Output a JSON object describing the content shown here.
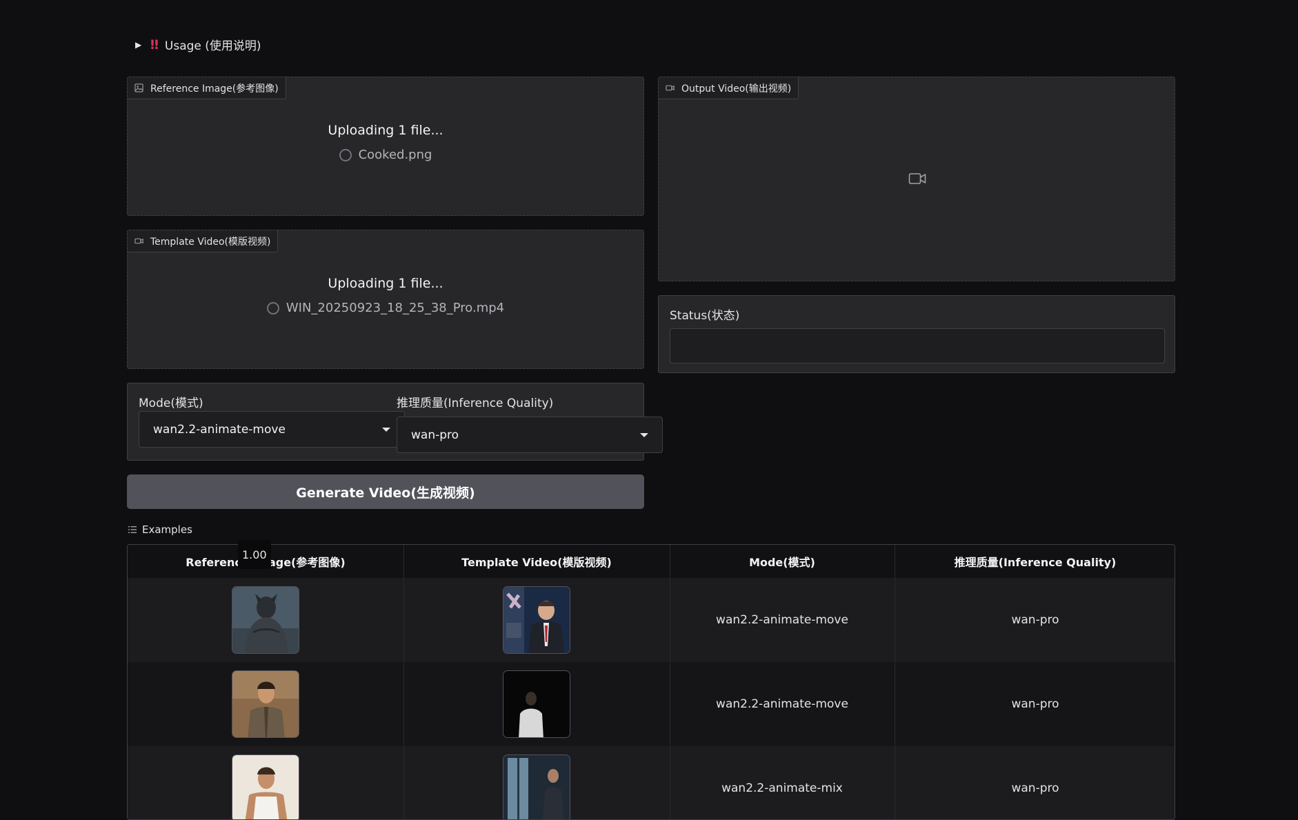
{
  "usage": {
    "label": "Usage (使用说明)",
    "arrow": "▶",
    "bang": "‼"
  },
  "reference_image": {
    "label": "Reference Image(参考图像)",
    "uploading": "Uploading 1 file...",
    "file": "Cooked.png"
  },
  "template_video": {
    "label": "Template Video(模版视频)",
    "uploading": "Uploading 1 file...",
    "file": "WIN_20250923_18_25_38_Pro.mp4"
  },
  "output_video": {
    "label": "Output Video(输出视频)"
  },
  "status": {
    "label": "Status(状态)",
    "value": ""
  },
  "mode": {
    "label": "Mode(模式)",
    "value": "wan2.2-animate-move"
  },
  "quality": {
    "label": "推理质量(Inference Quality)",
    "value": "wan-pro"
  },
  "generate_button": "Generate Video(生成视频)",
  "examples": {
    "label": "Examples",
    "tooltip": "1.00",
    "headers": [
      "Reference Image(参考图像)",
      "Template Video(模版视频)",
      "Mode(模式)",
      "推理质量(Inference Quality)"
    ],
    "rows": [
      {
        "mode": "wan2.2-animate-move",
        "quality": "wan-pro"
      },
      {
        "mode": "wan2.2-animate-move",
        "quality": "wan-pro"
      },
      {
        "mode": "wan2.2-animate-mix",
        "quality": "wan-pro"
      }
    ]
  },
  "colors": {
    "background": "#0f0f11",
    "panel": "#27272a",
    "button": "#52525b",
    "accent_bang": "#e0305a"
  }
}
